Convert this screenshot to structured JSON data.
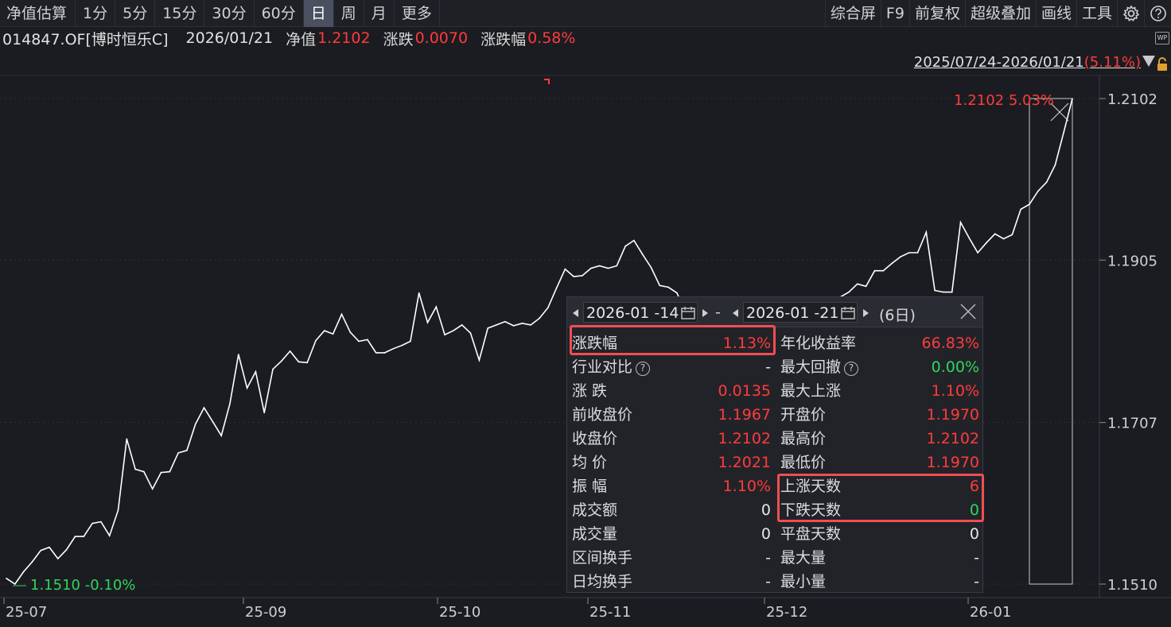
{
  "toolbar": {
    "periods": [
      "净值估算",
      "1分",
      "5分",
      "15分",
      "30分",
      "60分",
      "日",
      "周",
      "月",
      "更多"
    ],
    "active_period": "日",
    "right_items": [
      "综合屏",
      "F9",
      "前复权",
      "超级叠加",
      "画线",
      "工具"
    ],
    "icons": [
      "gear-icon",
      "help-icon"
    ]
  },
  "info": {
    "code": "014847.OF[博时恒乐C]",
    "date": "2026/01/21",
    "nav_label": "净值",
    "nav_value": "1.2102",
    "change_label": "涨跌",
    "change_value": "0.0070",
    "pct_label": "涨跌幅",
    "pct_value": "0.58%",
    "badge": "WP"
  },
  "range": {
    "text": "2025/07/24-2026/01/21",
    "open_paren": "(",
    "pct": "5.11%",
    "close_paren": ")"
  },
  "chart_data": {
    "type": "line",
    "x_ticks": [
      "25-07",
      "25-09",
      "25-10",
      "25-11",
      "25-12",
      "26-01"
    ],
    "y_ticks": [
      1.2102,
      1.1905,
      1.1707,
      1.151
    ],
    "y_tick_labels": [
      "1.2102",
      "1.1905",
      "1.1707",
      "1.1510"
    ],
    "ylim": [
      1.151,
      1.2102
    ],
    "max_label": "1.2102 5.03%",
    "min_label": "1.1510 -0.10%",
    "values": [
      1.1517,
      1.151,
      1.1525,
      1.1537,
      1.1551,
      1.1555,
      1.1541,
      1.1552,
      1.1568,
      1.1568,
      1.1584,
      1.1586,
      1.1569,
      1.16,
      1.1687,
      1.165,
      1.1647,
      1.1626,
      1.1646,
      1.1647,
      1.167,
      1.1673,
      1.1705,
      1.1725,
      1.1708,
      1.1691,
      1.173,
      1.179,
      1.1749,
      1.1769,
      1.1719,
      1.1772,
      1.1782,
      1.1794,
      1.1781,
      1.178,
      1.1807,
      1.1819,
      1.1815,
      1.1839,
      1.1817,
      1.1806,
      1.1808,
      1.1792,
      1.1792,
      1.1797,
      1.1801,
      1.1806,
      1.1865,
      1.1829,
      1.1848,
      1.1814,
      1.1819,
      1.1826,
      1.1816,
      1.1783,
      1.1822,
      1.1826,
      1.183,
      1.1825,
      1.1828,
      1.1826,
      1.1834,
      1.1847,
      1.1871,
      1.1894,
      1.1885,
      1.1886,
      1.1895,
      1.1898,
      1.1895,
      1.1898,
      1.1922,
      1.1929,
      1.1912,
      1.1896,
      1.1874,
      1.1872,
      1.1865,
      1.1842,
      1.184,
      1.1836,
      1.1825,
      1.182,
      1.183,
      1.182,
      1.1815,
      1.181,
      1.1812,
      1.1808,
      1.1812,
      1.1818,
      1.1822,
      1.1826,
      1.183,
      1.1845,
      1.1855,
      1.186,
      1.1866,
      1.1876,
      1.1873,
      1.1892,
      1.1892,
      1.1901,
      1.1909,
      1.1914,
      1.1914,
      1.1939,
      1.1868,
      1.1866,
      1.1866,
      1.1951,
      1.1932,
      1.1914,
      1.1926,
      1.1937,
      1.1931,
      1.1936,
      1.1967,
      1.1973,
      1.1989,
      1.2,
      1.2021,
      1.2061,
      1.2102
    ]
  },
  "popup": {
    "start_date": "2026-01 -14",
    "sep": "-",
    "end_date": "2026-01 -21",
    "days": "(6日)",
    "left_rows": [
      {
        "k": "涨跌幅",
        "v": "1.13%",
        "c": "red",
        "help": false
      },
      {
        "k": "行业对比",
        "v": "-",
        "c": "white",
        "help": true
      },
      {
        "k": "涨 跌",
        "v": "0.0135",
        "c": "red",
        "help": false
      },
      {
        "k": "前收盘价",
        "v": "1.1967",
        "c": "red",
        "help": false
      },
      {
        "k": "收盘价",
        "v": "1.2102",
        "c": "red",
        "help": false
      },
      {
        "k": "均 价",
        "v": "1.2021",
        "c": "red",
        "help": false
      },
      {
        "k": "振 幅",
        "v": "1.10%",
        "c": "red",
        "help": false
      },
      {
        "k": "成交额",
        "v": "0",
        "c": "white",
        "help": false
      },
      {
        "k": "成交量",
        "v": "0",
        "c": "white",
        "help": false
      },
      {
        "k": "区间换手",
        "v": "-",
        "c": "white",
        "help": false
      },
      {
        "k": "日均换手",
        "v": "-",
        "c": "white",
        "help": false
      }
    ],
    "right_rows": [
      {
        "k": "年化收益率",
        "v": "66.83%",
        "c": "red",
        "help": false
      },
      {
        "k": "最大回撤",
        "v": "0.00%",
        "c": "green",
        "help": true
      },
      {
        "k": "最大上涨",
        "v": "1.10%",
        "c": "red",
        "help": false
      },
      {
        "k": "开盘价",
        "v": "1.1970",
        "c": "red",
        "help": false
      },
      {
        "k": "最高价",
        "v": "1.2102",
        "c": "red",
        "help": false
      },
      {
        "k": "最低价",
        "v": "1.1970",
        "c": "red",
        "help": false
      },
      {
        "k": "上涨天数",
        "v": "6",
        "c": "red",
        "help": false
      },
      {
        "k": "下跌天数",
        "v": "0",
        "c": "green",
        "help": false
      },
      {
        "k": "平盘天数",
        "v": "0",
        "c": "white",
        "help": false
      },
      {
        "k": "最大量",
        "v": "-",
        "c": "white",
        "help": false
      },
      {
        "k": "最小量",
        "v": "-",
        "c": "white",
        "help": false
      }
    ]
  },
  "colors": {
    "background": "#1b1c21",
    "line": "#ffffff",
    "up": "#ff3b3b",
    "down": "#2fd55a",
    "highlight": "#f04e52"
  }
}
